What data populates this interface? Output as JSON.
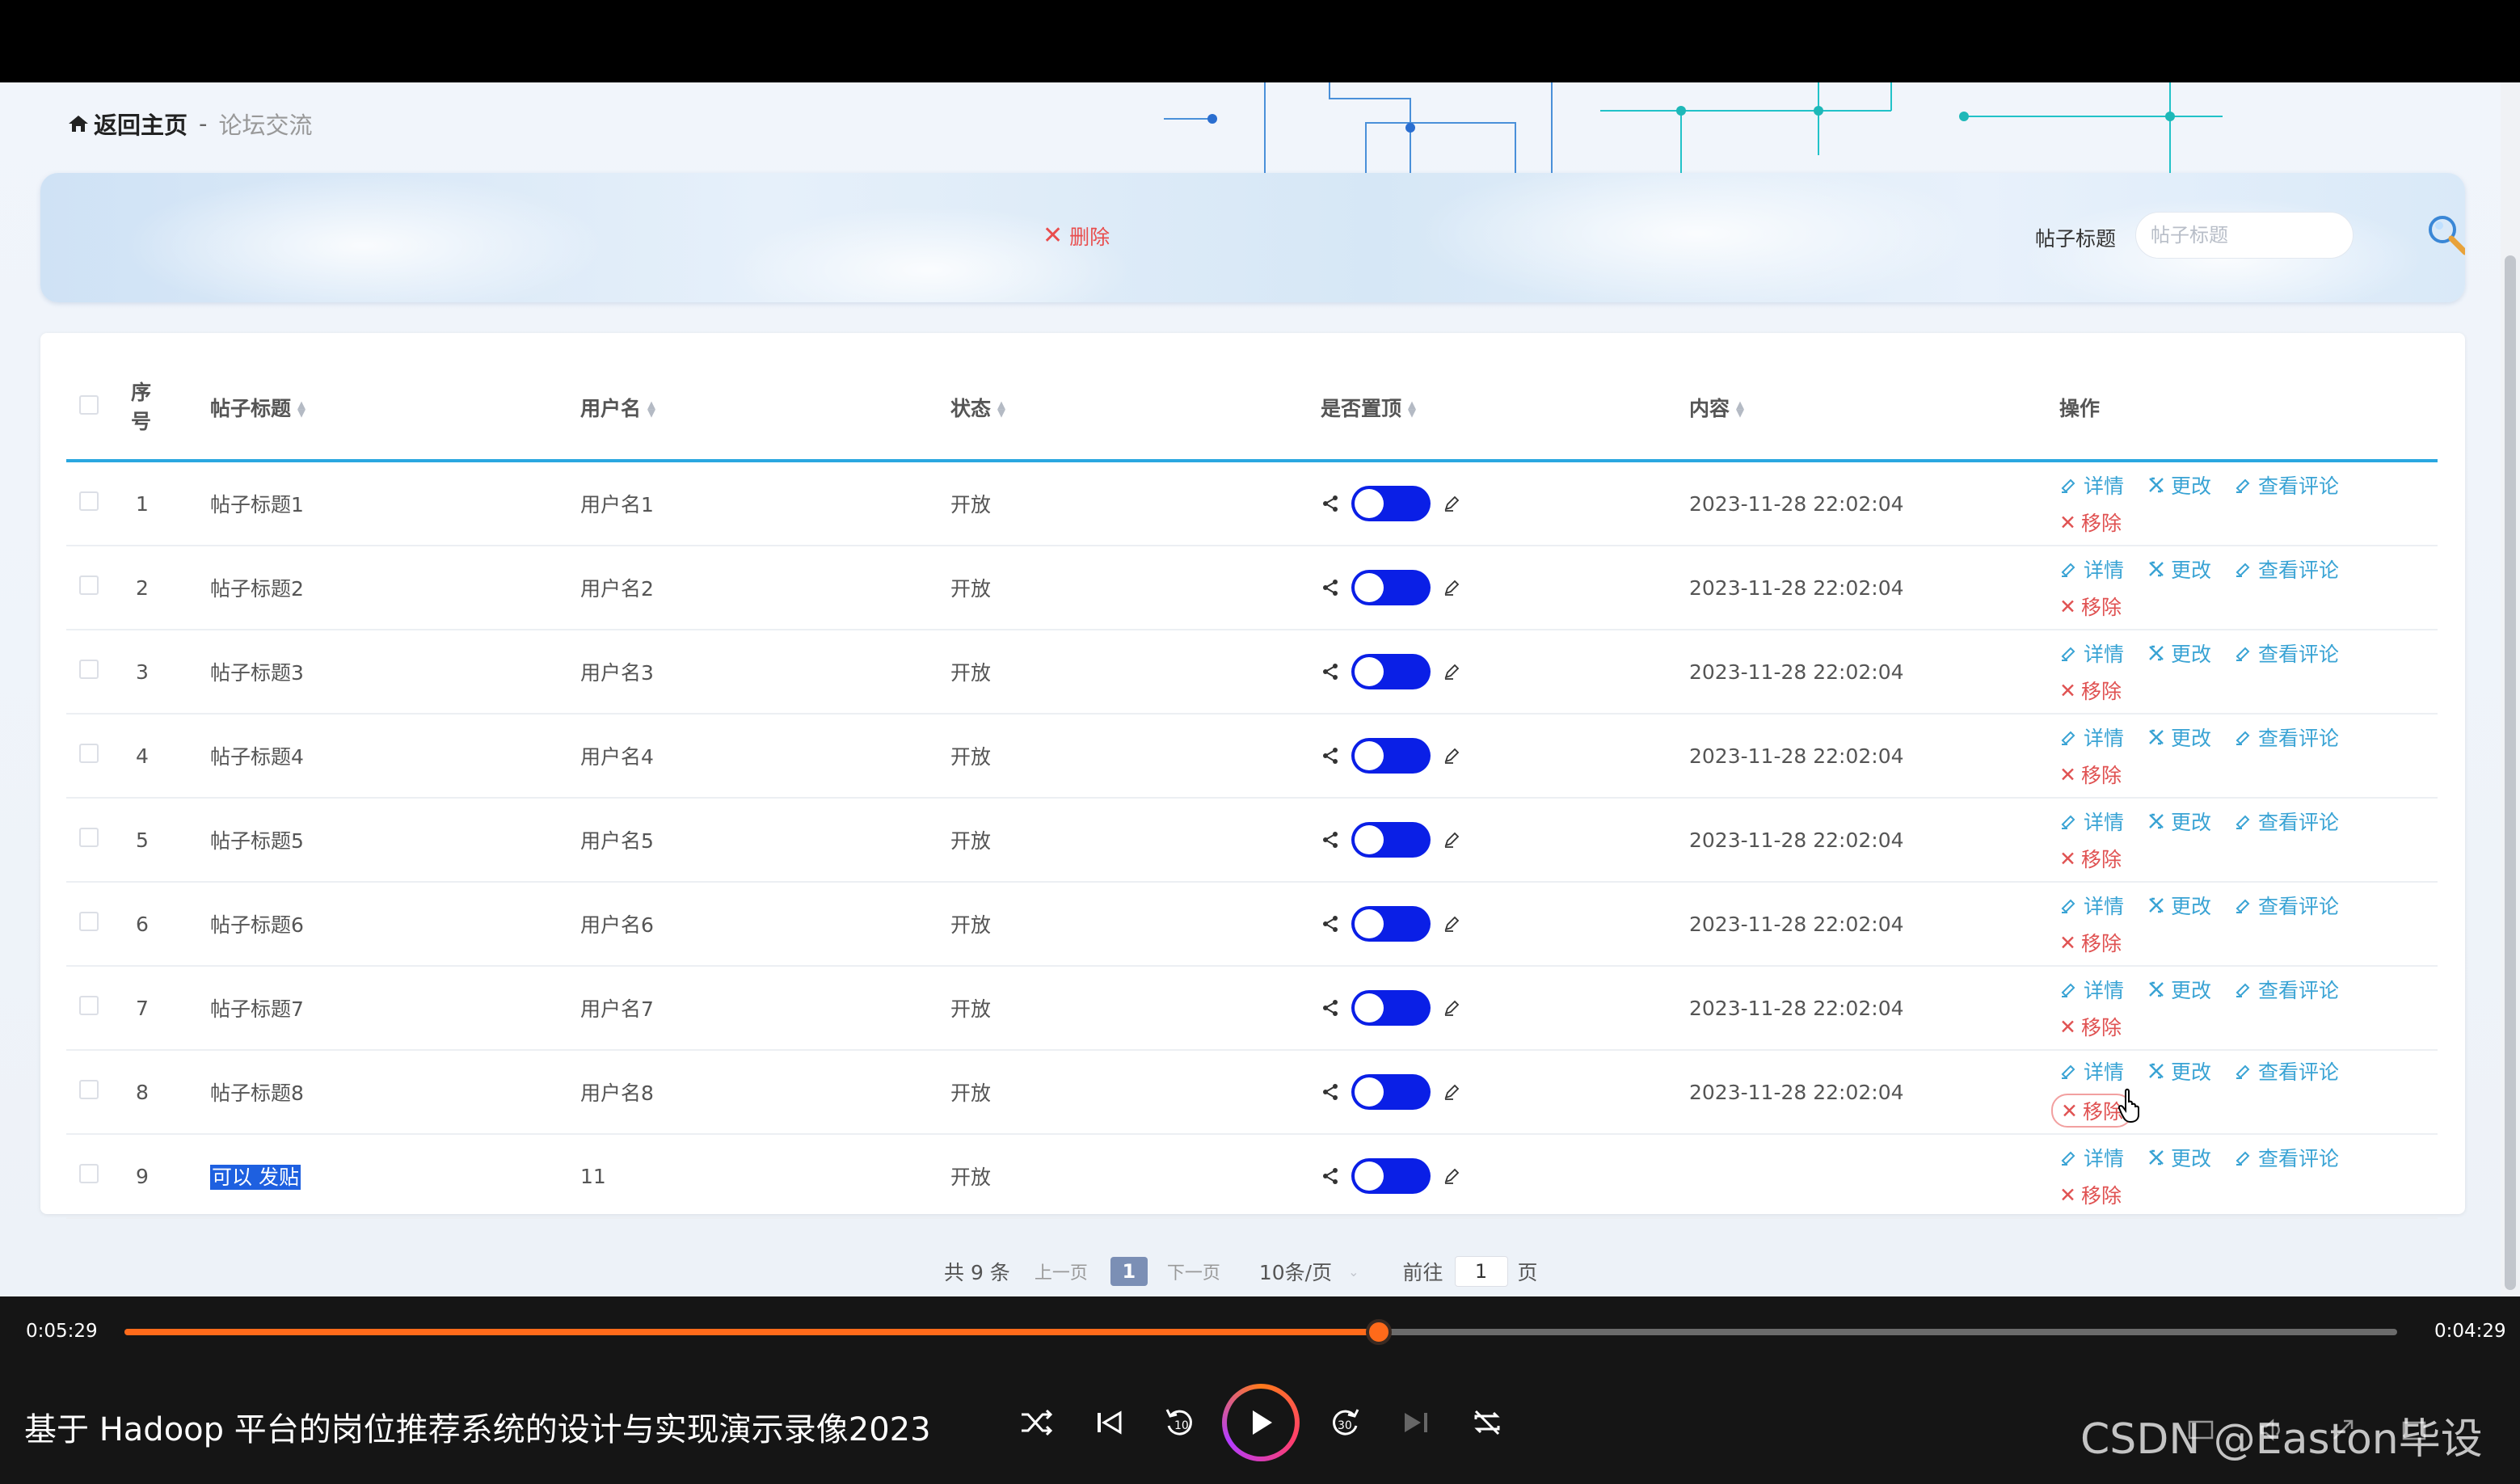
{
  "breadcrumb": {
    "home": "返回主页",
    "separator": "-",
    "current": "论坛交流"
  },
  "search": {
    "delete_label": "删除",
    "label": "帖子标题",
    "placeholder": "帖子标题"
  },
  "table": {
    "columns": [
      "序号",
      "帖子标题",
      "用户名",
      "状态",
      "是否置顶",
      "内容",
      "操作"
    ],
    "rows": [
      {
        "index": "1",
        "title": "帖子标题1",
        "username": "用户名1",
        "status": "开放",
        "pinned": true,
        "content": "2023-11-28 22:02:04"
      },
      {
        "index": "2",
        "title": "帖子标题2",
        "username": "用户名2",
        "status": "开放",
        "pinned": true,
        "content": "2023-11-28 22:02:04"
      },
      {
        "index": "3",
        "title": "帖子标题3",
        "username": "用户名3",
        "status": "开放",
        "pinned": true,
        "content": "2023-11-28 22:02:04"
      },
      {
        "index": "4",
        "title": "帖子标题4",
        "username": "用户名4",
        "status": "开放",
        "pinned": true,
        "content": "2023-11-28 22:02:04"
      },
      {
        "index": "5",
        "title": "帖子标题5",
        "username": "用户名5",
        "status": "开放",
        "pinned": true,
        "content": "2023-11-28 22:02:04"
      },
      {
        "index": "6",
        "title": "帖子标题6",
        "username": "用户名6",
        "status": "开放",
        "pinned": true,
        "content": "2023-11-28 22:02:04"
      },
      {
        "index": "7",
        "title": "帖子标题7",
        "username": "用户名7",
        "status": "开放",
        "pinned": true,
        "content": "2023-11-28 22:02:04"
      },
      {
        "index": "8",
        "title": "帖子标题8",
        "username": "用户名8",
        "status": "开放",
        "pinned": true,
        "content": "2023-11-28 22:02:04"
      },
      {
        "index": "9",
        "title": "可以 发贴",
        "username": "11",
        "status": "开放",
        "pinned": true,
        "content": ""
      }
    ],
    "actions": {
      "detail": "详情",
      "edit": "更改",
      "comments": "查看评论",
      "remove": "移除"
    }
  },
  "pagination": {
    "total": "共 9 条",
    "prev": "上一页",
    "current_page": "1",
    "next": "下一页",
    "page_size": "10条/页",
    "goto_label": "前往",
    "goto_value": "1",
    "goto_suffix": "页"
  },
  "player": {
    "elapsed": "0:05:29",
    "remaining": "0:04:29",
    "progress": 0.552,
    "title": "基于 Hadoop 平台的岗位推荐系统的设计与实现演示录像2023"
  },
  "watermark": "CSDN @Easton毕设",
  "colors": {
    "accent": "#2aa7e0",
    "danger": "#e05252",
    "toggle": "#0a1fe6",
    "progress": "#ff6a1a"
  }
}
